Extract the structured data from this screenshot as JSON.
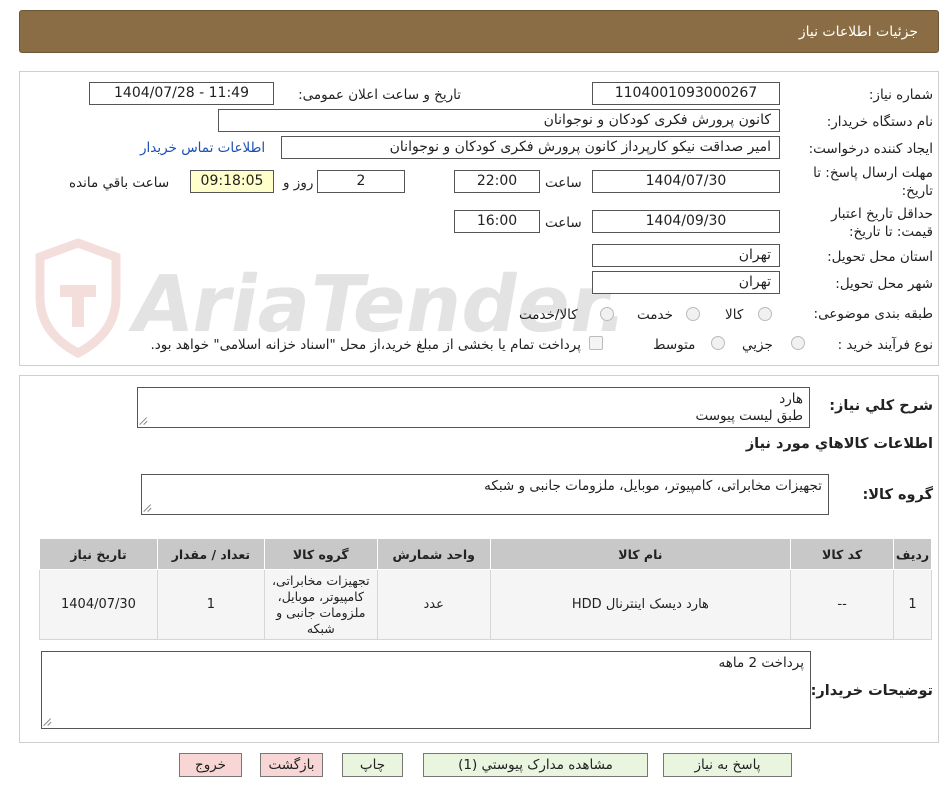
{
  "header": {
    "title": "جزئیات اطلاعات نیاز"
  },
  "watermark": {
    "text": "AriaTender.neT"
  },
  "info": {
    "need_number_label": "شماره نیاز:",
    "need_number": "1104001093000267",
    "announce_label": "تاریخ و ساعت اعلان عمومی:",
    "announce_value": "1404/07/28 - 11:49",
    "buyer_org_label": "نام دستگاه خریدار:",
    "buyer_org": "کانون پرورش فکری کودکان و نوجوانان",
    "creator_label": "ایجاد کننده درخواست:",
    "creator": "امیر صداقت نیکو کارپرداز کانون پرورش فکری کودکان و نوجوانان",
    "contact_link": "اطلاعات تماس خریدار",
    "deadline_label_1": "مهلت ارسال پاسخ: تا",
    "deadline_label_2": "تاریخ:",
    "deadline_date": "1404/07/30",
    "time_label": "ساعت",
    "deadline_time": "22:00",
    "days_value": "2",
    "days_label": "روز و",
    "remaining_time": "09:18:05",
    "remaining_label": "ساعت باقي مانده",
    "validity_label_1": "حداقل تاریخ اعتبار",
    "validity_label_2": "قیمت: تا تاریخ:",
    "validity_date": "1404/09/30",
    "validity_time": "16:00",
    "province_label": "استان محل تحویل:",
    "province": "تهران",
    "city_label": "شهر محل تحویل:",
    "city": "تهران",
    "category_label": "طبقه بندی موضوعی:",
    "category_options": [
      "کالا",
      "خدمت",
      "کالا/خدمت"
    ],
    "process_label": "نوع فرآیند خرید :",
    "process_options": [
      "جزیي",
      "متوسط"
    ],
    "payment_note": "پرداخت تمام یا بخشی از مبلغ خرید،از محل \"اسناد خزانه اسلامی\" خواهد بود."
  },
  "details": {
    "summary_label": "شرح کلي نياز:",
    "summary_lines": [
      "هارد",
      "طبق لیست پیوست"
    ],
    "goods_section_title": "اطلاعات کالاهاي مورد نياز",
    "goods_group_label": "گروه کالا:",
    "goods_group_value": "تجهیزات مخابراتی، کامپیوتر، موبایل، ملزومات جانبی و شبکه",
    "table": {
      "headers": [
        "رديف",
        "کد کالا",
        "نام کالا",
        "واحد شمارش",
        "گروه کالا",
        "تعداد / مقدار",
        "تاريخ نياز"
      ],
      "rows": [
        [
          "1",
          "--",
          "هارد دیسک اینترنال HDD",
          "عدد",
          "تجهیزات مخابراتی، کامپیوتر، موبایل، ملزومات جانبی و شبکه",
          "1",
          "1404/07/30"
        ]
      ]
    },
    "buyer_notes_label": "توضیحات خریدار:",
    "buyer_notes": "پرداخت 2 ماهه"
  },
  "buttons": {
    "respond": "پاسخ به نیاز",
    "view_docs": "مشاهده مدارک پیوستي (1)",
    "print": "چاپ",
    "back": "بازگشت",
    "exit": "خروج"
  }
}
